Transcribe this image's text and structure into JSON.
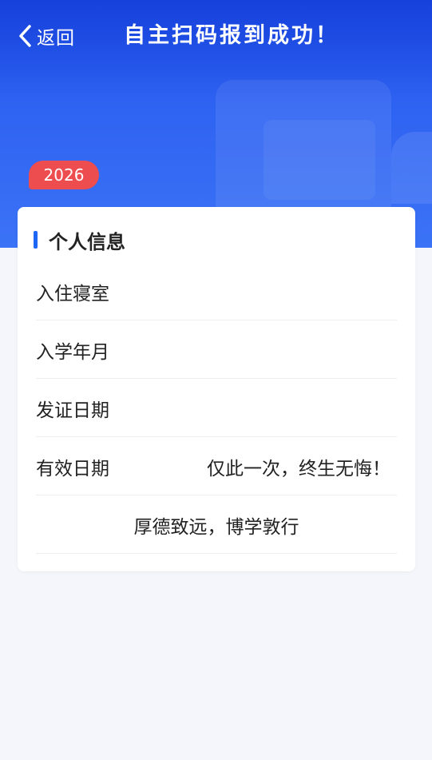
{
  "header": {
    "back_label": "返回",
    "title": "自主扫码报到成功！"
  },
  "badge": {
    "year": "2026"
  },
  "card": {
    "title": "个人信息",
    "rows": [
      {
        "label": "入住寝室",
        "value": ""
      },
      {
        "label": "入学年月",
        "value": ""
      },
      {
        "label": "发证日期",
        "value": ""
      },
      {
        "label": "有效日期",
        "value": "仅此一次，终生无悔！"
      }
    ],
    "motto": "厚德致远，博学敦行"
  },
  "colors": {
    "header_blue": "#2f63f2",
    "badge_red": "#ee4d4f",
    "accent_bar": "#1e66f5"
  }
}
